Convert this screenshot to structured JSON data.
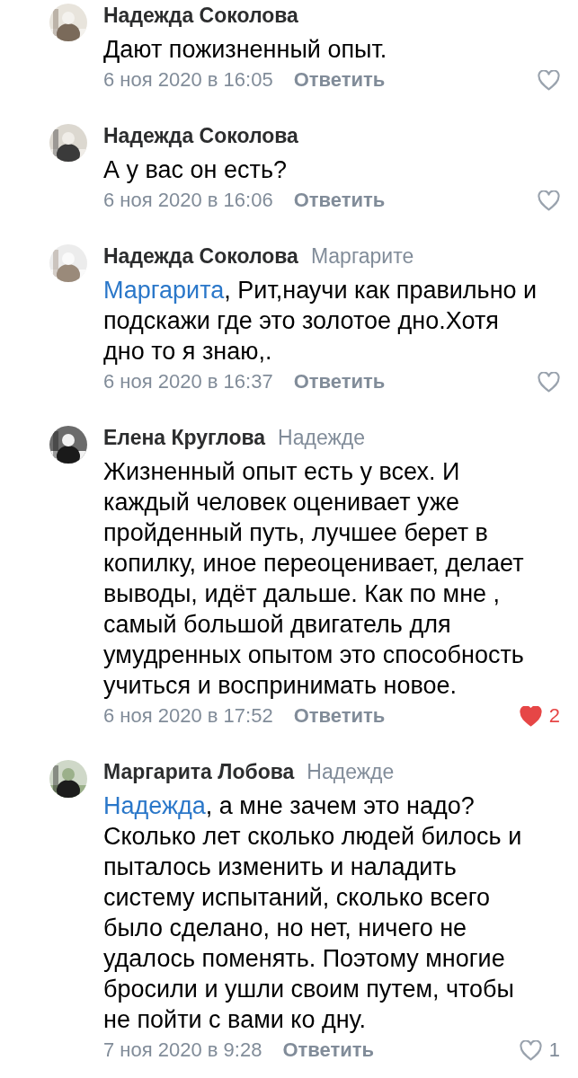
{
  "comments": [
    {
      "author": "Надежда Соколова",
      "text": "Дают пожизненный опыт.",
      "date": "6 ноя 2020 в 16:05",
      "reply": "Ответить",
      "liked": false
    },
    {
      "author": "Надежда Соколова",
      "text": "А у вас он есть?",
      "date": "6 ноя 2020 в 16:06",
      "reply": "Ответить",
      "liked": false
    },
    {
      "author": "Надежда Соколова",
      "reply_to": "Маргарите",
      "mention": "Маргарита",
      "text": ", Рит,научи как правильно и подскажи где это золотое дно.Хотя дно то я знаю,.",
      "date": "6 ноя 2020 в 16:37",
      "reply": "Ответить",
      "liked": false
    },
    {
      "author": "Елена Круглова",
      "reply_to": "Надежде",
      "text": "Жизненный опыт есть у всех. И каждый человек оценивает уже пройденный путь, лучшее берет в копилку, иное переоценивает, делает выводы, идёт дальше. Как по мне , самый большой двигатель для умудренных опытом это способность учиться и воспринимать новое.",
      "date": "6 ноя 2020 в 17:52",
      "reply": "Ответить",
      "liked": true,
      "likes": "2"
    },
    {
      "author": "Маргарита Лобова",
      "reply_to": "Надежде",
      "mention": "Надежда",
      "text": ", а мне зачем это надо? Сколько лет сколько людей билось и пыталось изменить и  наладить систему испытаний, сколько всего было сделано, но нет, ничего не удалось поменять. Поэтому многие бросили и ушли своим путем, чтобы не пойти с вами ко дну.",
      "date": "7 ноя 2020 в 9:28",
      "reply": "Ответить",
      "liked": false,
      "likes": "1"
    }
  ]
}
